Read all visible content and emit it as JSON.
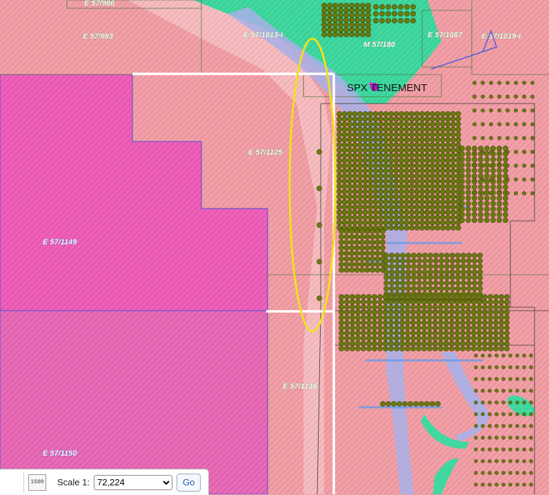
{
  "tenement_labels": {
    "e57_986": "E 57/986",
    "e57_983": "E 57/983",
    "e57_1013": "E 57/1013-I",
    "m57_180": "M 57/180",
    "e57_1087": "E 57/1087",
    "e57_1019": "E 57/1019-I",
    "e57_1125": "E 57/1125",
    "e57_1149": "E 57/1149",
    "e57_1136": "E 57/1136",
    "e57_1150": "E 57/1150"
  },
  "annotation": {
    "spx": "SPX TENEMENT"
  },
  "scale_control": {
    "icon_text": "1500",
    "label": "Scale 1:",
    "selected": "72,224",
    "go_label": "Go"
  },
  "colors": {
    "pink": "#f0a0a8",
    "magenta": "#f060b8",
    "green_geology": "#40d8a0",
    "blue_channel": "#a8b0e8",
    "drillhole": "#6a7a10",
    "highlight_ellipse": "#f0e020",
    "boundary_white": "#ffffff"
  }
}
